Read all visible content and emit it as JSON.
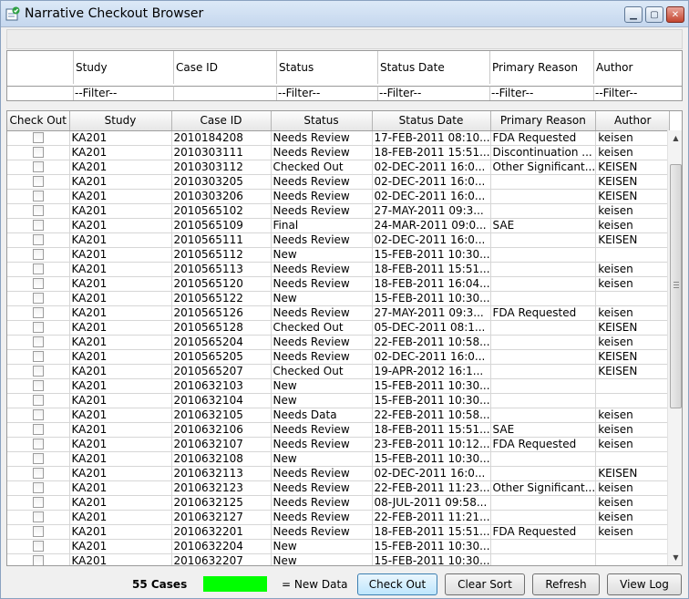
{
  "window": {
    "title": "Narrative Checkout Browser"
  },
  "filter_panel": {
    "headers": [
      "Study",
      "Case ID",
      "Status",
      "Status Date",
      "Primary Reason",
      "Author"
    ],
    "filters": [
      "--Filter--",
      "",
      "--Filter--",
      "--Filter--",
      "--Filter--",
      "--Filter--"
    ]
  },
  "grid": {
    "columns": [
      "Check Out",
      "Study",
      "Case ID",
      "Status",
      "Status Date",
      "Primary Reason",
      "Author"
    ],
    "rows": [
      [
        "KA201",
        "2010184208",
        "Needs Review",
        "17-FEB-2011 08:10...",
        "FDA Requested",
        "keisen"
      ],
      [
        "KA201",
        "2010303111",
        "Needs Review",
        "18-FEB-2011 15:51...",
        "Discontinuation ...",
        "keisen"
      ],
      [
        "KA201",
        "2010303112",
        "Checked Out",
        "02-DEC-2011 16:0...",
        "Other Significant...",
        "KEISEN"
      ],
      [
        "KA201",
        "2010303205",
        "Needs Review",
        "02-DEC-2011 16:0...",
        "",
        "KEISEN"
      ],
      [
        "KA201",
        "2010303206",
        "Needs Review",
        "02-DEC-2011 16:0...",
        "",
        "KEISEN"
      ],
      [
        "KA201",
        "2010565102",
        "Needs Review",
        "27-MAY-2011 09:3...",
        "",
        "keisen"
      ],
      [
        "KA201",
        "2010565109",
        "Final",
        "24-MAR-2011 09:0...",
        "SAE",
        "keisen"
      ],
      [
        "KA201",
        "2010565111",
        "Needs Review",
        "02-DEC-2011 16:0...",
        "",
        "KEISEN"
      ],
      [
        "KA201",
        "2010565112",
        "New",
        "15-FEB-2011 10:30...",
        "",
        ""
      ],
      [
        "KA201",
        "2010565113",
        "Needs Review",
        "18-FEB-2011 15:51...",
        "",
        "keisen"
      ],
      [
        "KA201",
        "2010565120",
        "Needs Review",
        "18-FEB-2011 16:04...",
        "",
        "keisen"
      ],
      [
        "KA201",
        "2010565122",
        "New",
        "15-FEB-2011 10:30...",
        "",
        ""
      ],
      [
        "KA201",
        "2010565126",
        "Needs Review",
        "27-MAY-2011 09:3...",
        "FDA Requested",
        "keisen"
      ],
      [
        "KA201",
        "2010565128",
        "Checked Out",
        "05-DEC-2011 08:1...",
        "",
        "KEISEN"
      ],
      [
        "KA201",
        "2010565204",
        "Needs Review",
        "22-FEB-2011 10:58...",
        "",
        "keisen"
      ],
      [
        "KA201",
        "2010565205",
        "Needs Review",
        "02-DEC-2011 16:0...",
        "",
        "KEISEN"
      ],
      [
        "KA201",
        "2010565207",
        "Checked Out",
        "19-APR-2012 16:1...",
        "",
        "KEISEN"
      ],
      [
        "KA201",
        "2010632103",
        "New",
        "15-FEB-2011 10:30...",
        "",
        ""
      ],
      [
        "KA201",
        "2010632104",
        "New",
        "15-FEB-2011 10:30...",
        "",
        ""
      ],
      [
        "KA201",
        "2010632105",
        "Needs Data",
        "22-FEB-2011 10:58...",
        "",
        "keisen"
      ],
      [
        "KA201",
        "2010632106",
        "Needs Review",
        "18-FEB-2011 15:51...",
        "SAE",
        "keisen"
      ],
      [
        "KA201",
        "2010632107",
        "Needs Review",
        "23-FEB-2011 10:12...",
        "FDA Requested",
        "keisen"
      ],
      [
        "KA201",
        "2010632108",
        "New",
        "15-FEB-2011 10:30...",
        "",
        ""
      ],
      [
        "KA201",
        "2010632113",
        "Needs Review",
        "02-DEC-2011 16:0...",
        "",
        "KEISEN"
      ],
      [
        "KA201",
        "2010632123",
        "Needs Review",
        "22-FEB-2011 11:23...",
        "Other Significant...",
        "keisen"
      ],
      [
        "KA201",
        "2010632125",
        "Needs Review",
        "08-JUL-2011 09:58...",
        "",
        "keisen"
      ],
      [
        "KA201",
        "2010632127",
        "Needs Review",
        "22-FEB-2011 11:21...",
        "",
        "keisen"
      ],
      [
        "KA201",
        "2010632201",
        "Needs Review",
        "18-FEB-2011 15:51...",
        "FDA Requested",
        "keisen"
      ],
      [
        "KA201",
        "2010632204",
        "New",
        "15-FEB-2011 10:30...",
        "",
        ""
      ],
      [
        "KA201",
        "2010632207",
        "New",
        "15-FEB-2011 10:30...",
        "",
        ""
      ]
    ]
  },
  "footer": {
    "case_count": "55 Cases",
    "legend_color": "#00ff00",
    "legend_label": "= New Data",
    "buttons": {
      "check_out": "Check Out",
      "clear_sort": "Clear Sort",
      "refresh": "Refresh",
      "view_log": "View Log"
    }
  },
  "icons": {
    "app": "app-check-icon",
    "minimize": "minimize-icon",
    "maximize": "maximize-icon",
    "close": "close-icon",
    "scroll_up": "scroll-up-arrow-icon",
    "scroll_down": "scroll-down-arrow-icon"
  }
}
